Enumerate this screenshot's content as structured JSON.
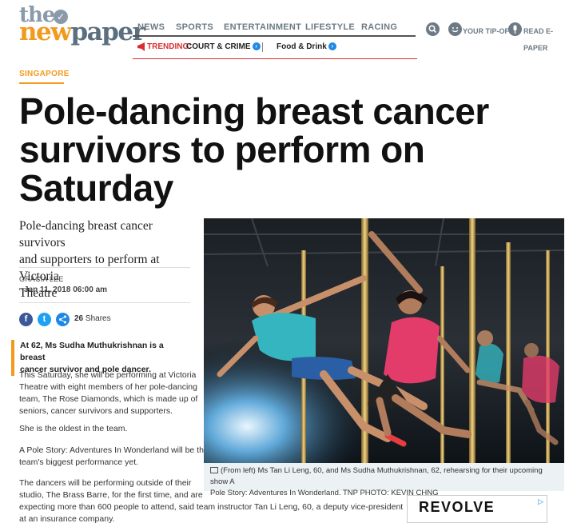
{
  "logo": {
    "the": "the",
    "new": "new",
    "paper": "paper"
  },
  "nav": {
    "items": [
      "NEWS",
      "SPORTS",
      "ENTERTAINMENT",
      "LIFESTYLE",
      "RACING"
    ]
  },
  "trending": {
    "label": "TRENDING:",
    "items": [
      "COURT & CRIME",
      "Food & Drink"
    ]
  },
  "tools": {
    "tipoffs": "YOUR TIP-OFFS",
    "read1": "READ E-",
    "read2": "PAPER"
  },
  "article": {
    "section": "SINGAPORE",
    "headline_lines": [
      "Pole-dancing breast cancer",
      "survivors to perform on",
      "Saturday"
    ],
    "standfirst_lines": [
      "Pole-dancing breast cancer survivors",
      "and supporters to perform at Victoria",
      "Theatre"
    ],
    "author": "GRACIA LEE",
    "date": "Jan 11, 2018 06:00 am",
    "shares_count": "26",
    "shares_label": "Shares",
    "pull_lines": [
      "At 62, Ms Sudha Muthukrishnan is a breast",
      "cancer survivor and pole dancer."
    ],
    "para1": [
      "This Saturday, she will be performing at Victoria",
      "Theatre with eight members of her pole-dancing",
      "team, The Rose Diamonds, which is made up of",
      "seniors, cancer survivors and supporters."
    ],
    "para2": [
      "She is the oldest in the team."
    ],
    "para3": [
      "A Pole Story: Adventures In Wonderland will be the",
      "team's biggest performance yet."
    ],
    "para4": [
      "The dancers will be performing outside of their",
      "studio, The Brass Barre, for the first time, and are",
      "expecting more than 600 people to attend, said team instructor Tan Li Leng, 60, a deputy vice-president",
      "at an insurance company."
    ],
    "caption_lines": [
      "(From left) Ms Tan Li Leng, 60, and Ms Sudha Muthukrishnan, 62, rehearsing for their upcoming show A",
      "Pole Story: Adventures In Wonderland.  TNP PHOTO: KEVIN CHNG"
    ]
  },
  "ad": {
    "brand": "REVOLVE"
  },
  "colors": {
    "accent": "#f29a1d",
    "trend_red": "#d92c32",
    "facebook": "#3b5998",
    "twitter": "#1da1f2",
    "share": "#1e88e5"
  }
}
